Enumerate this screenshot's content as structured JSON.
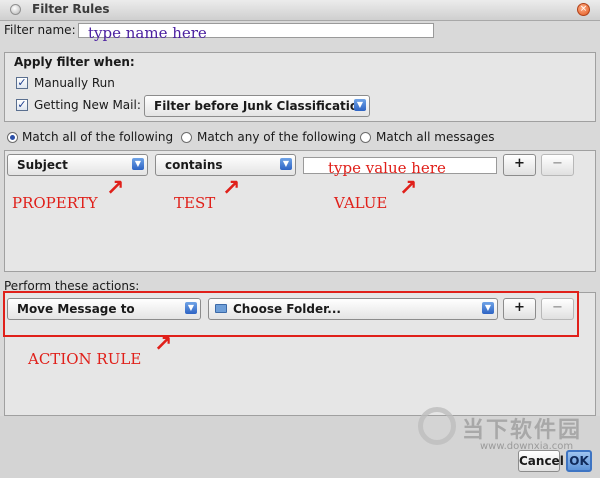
{
  "window": {
    "title": "Filter Rules"
  },
  "filter_name": {
    "label": "Filter name:",
    "value": "",
    "annotation": "type name here"
  },
  "apply_when": {
    "title": "Apply filter when:",
    "manually_run": {
      "label": "Manually Run",
      "checked": true
    },
    "getting_new_mail": {
      "label": "Getting New Mail:",
      "checked": true
    },
    "timing_select": "Filter before Junk Classification"
  },
  "match": {
    "options": [
      "Match all of the following",
      "Match any of the following",
      "Match all messages"
    ],
    "selected": "Match all of the following"
  },
  "condition": {
    "property": "Subject",
    "test": "contains",
    "value_annotation": "type value here",
    "add_label": "+",
    "remove_label": "−"
  },
  "annotations": {
    "property": "PROPERTY",
    "test": "TEST",
    "value": "VALUE",
    "action": "ACTION RULE",
    "arrow": "↗"
  },
  "actions": {
    "label": "Perform these actions:",
    "action_select": "Move Message to",
    "folder_select": "Choose Folder...",
    "add_label": "+",
    "remove_label": "−"
  },
  "buttons": {
    "cancel": "Cancel",
    "ok": "OK"
  },
  "watermark": {
    "text": "当下软件园",
    "url": "www.downxia.com"
  },
  "icons": {
    "chevron": "chevron-down-icon",
    "folder": "folder-icon",
    "check": "checkmark-icon",
    "close": "close-icon"
  },
  "colors": {
    "annotation_red": "#e0201a",
    "annotation_purple": "#4a1fa0",
    "accent_blue": "#2e64c4"
  }
}
